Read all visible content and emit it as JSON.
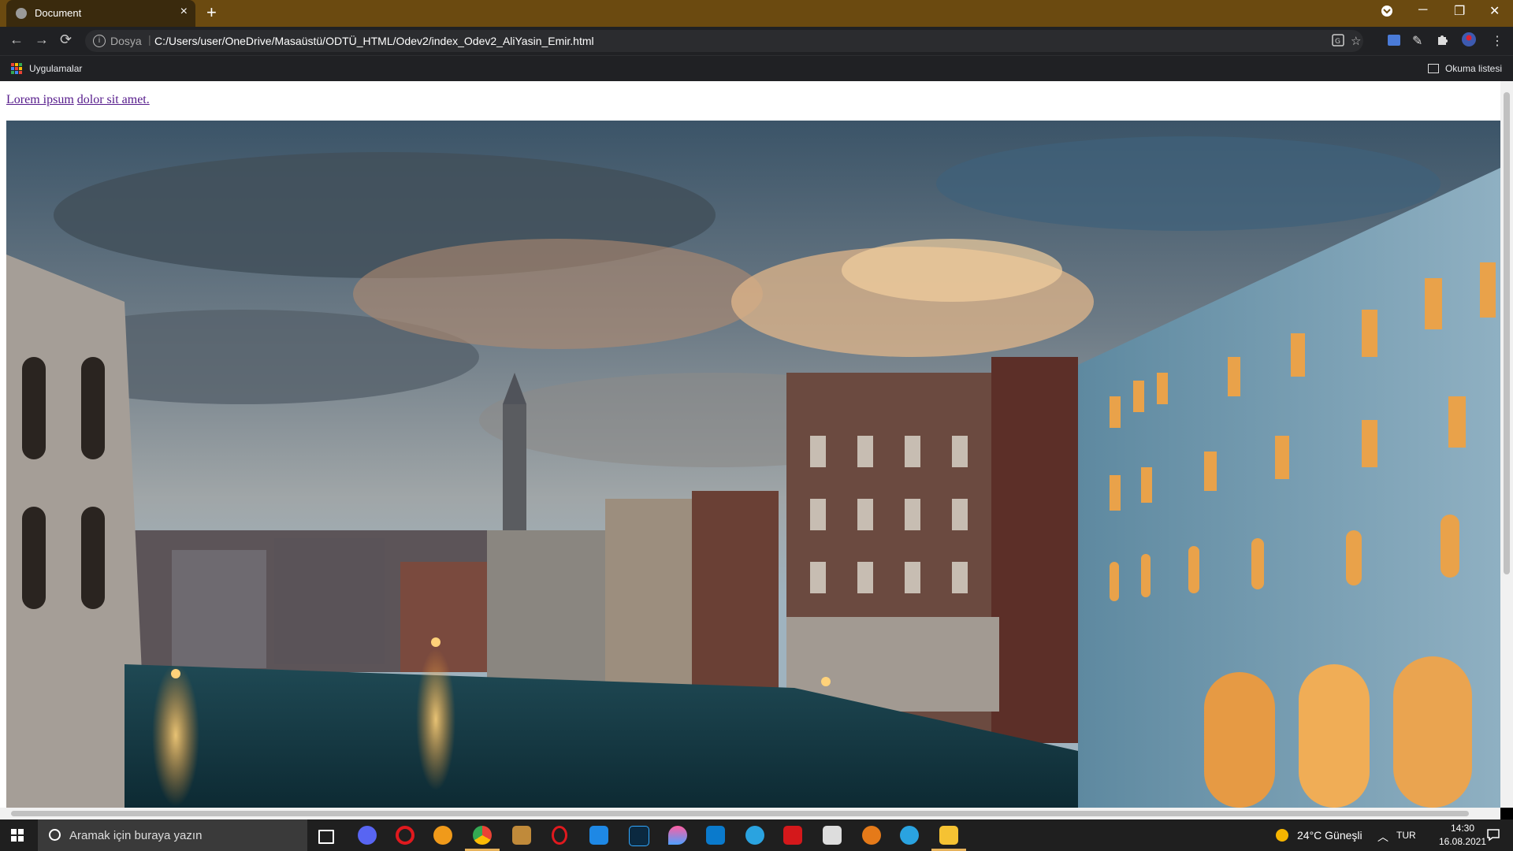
{
  "browser": {
    "tab_title": "Document",
    "tab_close": "×",
    "new_tab": "+",
    "window": {
      "minimize": "─",
      "restore": "❐",
      "close": "✕"
    },
    "nav": {
      "back": "←",
      "forward": "→",
      "reload": "⟳"
    },
    "address": {
      "scheme_label": "Dosya",
      "url": "C:/Users/user/OneDrive/Masaüstü/ODTÜ_HTML/Odev2/index_Odev2_AliYasin_Emir.html"
    },
    "bookmarks": {
      "apps_label": "Uygulamalar",
      "reading_list_label": "Okuma listesi"
    }
  },
  "page": {
    "links": [
      {
        "text": "Lorem ipsum"
      },
      {
        "text": "dolor sit amet."
      }
    ],
    "image_subject": "venice-grand-canal-sunset"
  },
  "taskbar": {
    "search_placeholder": "Aramak için buraya yazın",
    "weather": "24°C  Güneşli",
    "language": "TUR",
    "time": "14:30",
    "date": "16.08.2021"
  },
  "colors": {
    "tab_bar": "#6b4a10",
    "toolbar": "#202124",
    "link_visited": "#551a8b",
    "taskbar": "#1f1f1f"
  }
}
